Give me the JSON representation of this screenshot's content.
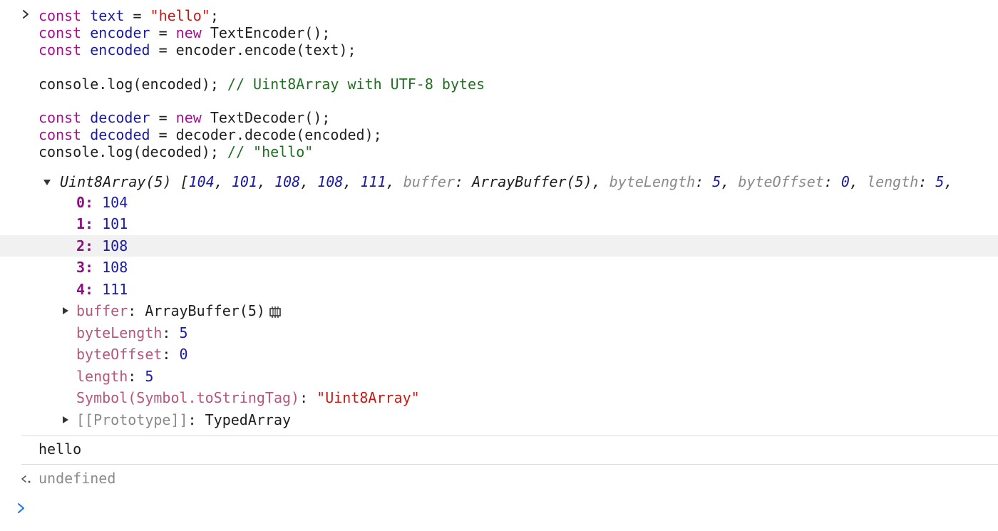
{
  "input_code": {
    "lines": [
      [
        {
          "t": "const ",
          "c": "kw"
        },
        {
          "t": "text",
          "c": "var"
        },
        {
          "t": " = ",
          "c": "plain"
        },
        {
          "t": "\"hello\"",
          "c": "str"
        },
        {
          "t": ";",
          "c": "plain"
        }
      ],
      [
        {
          "t": "const ",
          "c": "kw"
        },
        {
          "t": "encoder",
          "c": "var"
        },
        {
          "t": " = ",
          "c": "plain"
        },
        {
          "t": "new ",
          "c": "kw"
        },
        {
          "t": "TextEncoder();",
          "c": "plain"
        }
      ],
      [
        {
          "t": "const ",
          "c": "kw"
        },
        {
          "t": "encoded",
          "c": "var"
        },
        {
          "t": " = encoder.encode(text);",
          "c": "plain"
        }
      ],
      [],
      [
        {
          "t": "console.log(encoded); ",
          "c": "plain"
        },
        {
          "t": "// Uint8Array with UTF-8 bytes",
          "c": "cmt"
        }
      ],
      [],
      [
        {
          "t": "const ",
          "c": "kw"
        },
        {
          "t": "decoder",
          "c": "var"
        },
        {
          "t": " = ",
          "c": "plain"
        },
        {
          "t": "new ",
          "c": "kw"
        },
        {
          "t": "TextDecoder();",
          "c": "plain"
        }
      ],
      [
        {
          "t": "const ",
          "c": "kw"
        },
        {
          "t": "decoded",
          "c": "var"
        },
        {
          "t": " = decoder.decode(encoded);",
          "c": "plain"
        }
      ],
      [
        {
          "t": "console.log(decoded); ",
          "c": "plain"
        },
        {
          "t": "// \"hello\"",
          "c": "cmt"
        }
      ]
    ]
  },
  "summary": {
    "label": "Uint8Array(5)",
    "open_bracket": "[",
    "values": [
      "104",
      "101",
      "108",
      "108",
      "111"
    ],
    "buffer_key": "buffer",
    "buffer_val": "ArrayBuffer(5)",
    "bytelength_key": "byteLength",
    "bytelength_val": "5",
    "byteoffset_key": "byteOffset",
    "byteoffset_val": "0",
    "length_key": "length",
    "length_val": "5"
  },
  "entries": [
    {
      "key": "0",
      "value": "104"
    },
    {
      "key": "1",
      "value": "101"
    },
    {
      "key": "2",
      "value": "108"
    },
    {
      "key": "3",
      "value": "108"
    },
    {
      "key": "4",
      "value": "111"
    }
  ],
  "props": {
    "buffer_key": "buffer",
    "buffer_val": "ArrayBuffer(5)",
    "bytelength_key": "byteLength",
    "bytelength_val": "5",
    "byteoffset_key": "byteOffset",
    "byteoffset_val": "0",
    "length_key": "length",
    "length_val": "5",
    "symbol_key": "Symbol(Symbol.toStringTag)",
    "symbol_val": "\"Uint8Array\"",
    "prototype_key": "[[Prototype]]",
    "prototype_val": "TypedArray"
  },
  "log_output": "hello",
  "return_value": "undefined",
  "colors": {
    "keyword": "#aa0d91",
    "variable": "#1a1aa6",
    "string": "#c41a16",
    "comment": "#236e25",
    "index_key": "#881280",
    "property": "#b5577a",
    "number": "#1a1aa6",
    "prompt": "#1a73e8"
  },
  "icons": {
    "input_prompt": "chevron-right-icon",
    "expand": "triangle-down-icon",
    "collapse": "triangle-right-icon",
    "memory": "memory-inspector-icon",
    "return": "return-arrow-icon"
  }
}
